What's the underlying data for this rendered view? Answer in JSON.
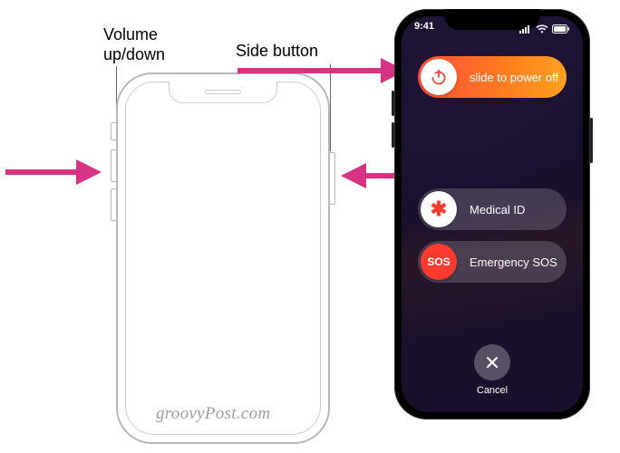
{
  "labels": {
    "volume": "Volume\nup/down",
    "side": "Side button"
  },
  "watermark": "groovyPost.com",
  "phone_screen": {
    "status": {
      "time": "9:41"
    },
    "sliders": {
      "power": {
        "label": "slide to power off"
      },
      "medical": {
        "label": "Medical ID",
        "knob_text": "✱"
      },
      "sos": {
        "label": "Emergency SOS",
        "knob_text": "SOS"
      }
    },
    "cancel": {
      "label": "Cancel"
    }
  }
}
